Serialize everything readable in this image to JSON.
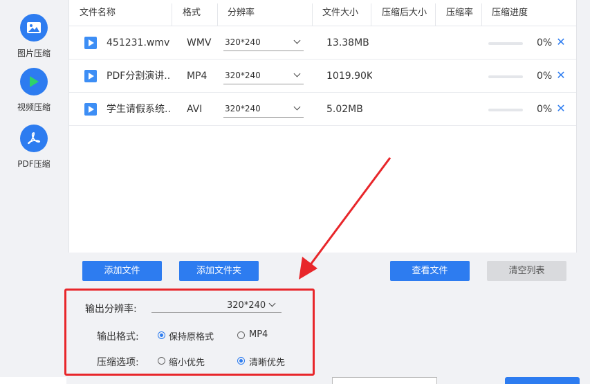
{
  "sidebar": {
    "items": [
      {
        "label": "图片压缩",
        "icon": "image-icon"
      },
      {
        "label": "视频压缩",
        "icon": "play-icon"
      },
      {
        "label": "PDF压缩",
        "icon": "pdf-icon"
      }
    ]
  },
  "table": {
    "headers": [
      "文件名称",
      "格式",
      "分辨率",
      "文件大小",
      "压缩后大小",
      "压缩率",
      "压缩进度"
    ],
    "rows": [
      {
        "name": "451231.wmv",
        "format": "WMV",
        "resolution": "320*240",
        "size": "13.38MB",
        "progress": 0,
        "percent": "0%"
      },
      {
        "name": "PDF分割演讲...",
        "format": "MP4",
        "resolution": "320*240",
        "size": "1019.90KB",
        "progress": 0,
        "percent": "0%"
      },
      {
        "name": "学生请假系统...",
        "format": "AVI",
        "resolution": "320*240",
        "size": "5.02MB",
        "progress": 0,
        "percent": "0%"
      }
    ]
  },
  "buttons": {
    "add_file": "添加文件",
    "add_folder": "添加文件夹",
    "view_files": "查看文件",
    "clear_list": "清空列表"
  },
  "options": {
    "output_resolution_label": "输出分辨率:",
    "output_resolution_value": "320*240",
    "output_format_label": "输出格式:",
    "format_keep": "保持原格式",
    "format_mp4": "MP4",
    "compress_label": "压缩选项:",
    "compress_smaller": "缩小优先",
    "compress_clear": "清晰优先",
    "selected_format": "keep",
    "selected_compress": "clear"
  },
  "colors": {
    "accent": "#2d7cf0",
    "annotation": "#e8262a"
  }
}
